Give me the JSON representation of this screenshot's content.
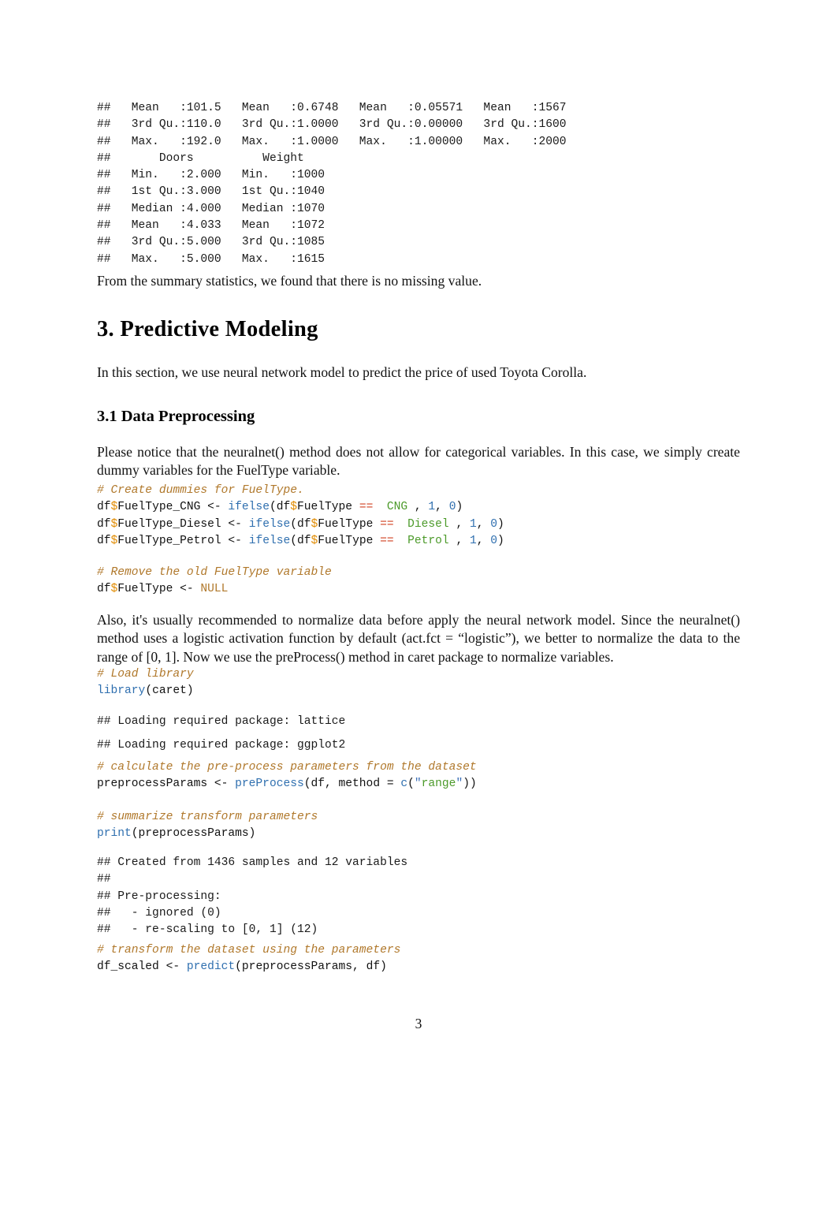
{
  "document": {
    "page_number": "3"
  },
  "summary_output": {
    "lines": [
      "##   Mean   :101.5   Mean   :0.6748   Mean   :0.05571   Mean   :1567",
      "##   3rd Qu.:110.0   3rd Qu.:1.0000   3rd Qu.:0.00000   3rd Qu.:1600",
      "##   Max.   :192.0   Max.   :1.0000   Max.   :1.00000   Max.   :2000",
      "##       Doors          Weight",
      "##   Min.   :2.000   Min.   :1000",
      "##   1st Qu.:3.000   1st Qu.:1040",
      "##   Median :4.000   Median :1070",
      "##   Mean   :4.033   Mean   :1072",
      "##   3rd Qu.:5.000   3rd Qu.:1085",
      "##   Max.   :5.000   Max.   :1615"
    ],
    "text": "##   Mean   :101.5   Mean   :0.6748   Mean   :0.05571   Mean   :1567\n##   3rd Qu.:110.0   3rd Qu.:1.0000   3rd Qu.:0.00000   3rd Qu.:1600\n##   Max.   :192.0   Max.   :1.0000   Max.   :1.00000   Max.   :2000\n##       Doors          Weight\n##   Min.   :2.000   Min.   :1000\n##   1st Qu.:3.000   1st Qu.:1040\n##   Median :4.000   Median :1070\n##   Mean   :4.033   Mean   :1072\n##   3rd Qu.:5.000   3rd Qu.:1085\n##   Max.   :5.000   Max.   :1615"
  },
  "paragraphs": {
    "missing_value": "From the summary statistics, we found that there is no missing value.",
    "section_intro": "In this section, we use neural network model to predict the price of used Toyota Corolla.",
    "notice_categorical": "Please notice that the neuralnet() method does not allow for categorical variables. In this case, we simply create dummy variables for the FuelType variable.",
    "normalize_note": "Also, it's usually recommended to normalize data before apply the neural network model. Since the neuralnet() method uses a logistic activation function by default (act.fct = “logistic”), we better to normalize the data to the range of [0, 1]. Now we use the preProcess() method in caret package to normalize variables."
  },
  "headings": {
    "section_3": "3.  Predictive Modeling",
    "section_3_1": "3.1 Data Preprocessing"
  },
  "code_dummies": {
    "comment": "# Create dummies for FuelType.",
    "line1": {
      "var": "df",
      "dollar": "$",
      "field": "FuelType_CNG",
      "assign": " <- ",
      "fn": "ifelse",
      "open": "(df",
      "dollar2": "$",
      "field2": "FuelType ",
      "eq": "==",
      "string": "  CNG ",
      "comma": ", ",
      "one": "1",
      "comma2": ", ",
      "zero": "0",
      "close": ")"
    },
    "line2": {
      "var": "df",
      "dollar": "$",
      "field": "FuelType_Diesel",
      "assign": " <- ",
      "fn": "ifelse",
      "open": "(df",
      "dollar2": "$",
      "field2": "FuelType ",
      "eq": "==",
      "string": "  Diesel ",
      "comma": ", ",
      "one": "1",
      "comma2": ", ",
      "zero": "0",
      "close": ")"
    },
    "line3": {
      "var": "df",
      "dollar": "$",
      "field": "FuelType_Petrol",
      "assign": " <- ",
      "fn": "ifelse",
      "open": "(df",
      "dollar2": "$",
      "field2": "FuelType ",
      "eq": "==",
      "string": "  Petrol ",
      "comma": ", ",
      "one": "1",
      "comma2": ", ",
      "zero": "0",
      "close": ")"
    }
  },
  "code_remove": {
    "comment": "# Remove the old FuelType variable",
    "var": "df",
    "dollar": "$",
    "field": "FuelType",
    "assign": " <- ",
    "value": "NULL"
  },
  "code_library": {
    "comment": "# Load library",
    "fn": "library",
    "args": "(caret)"
  },
  "output_lattice": "## Loading required package: lattice",
  "output_ggplot": "## Loading required package: ggplot2",
  "code_preprocess": {
    "comment": "# calculate the pre-process parameters from the dataset",
    "var": "preprocessParams <- ",
    "fn": "preProcess",
    "open": "(df, ",
    "arg": "method",
    "eqsign": " = ",
    "cfn": "c",
    "paren": "(",
    "q1": "\"",
    "string": "range",
    "q2": "\"",
    "close": "))"
  },
  "code_print": {
    "comment": "# summarize transform parameters",
    "fn": "print",
    "args": "(preprocessParams)"
  },
  "output_preprocess": {
    "lines": [
      "## Created from 1436 samples and 12 variables",
      "##",
      "## Pre-processing:",
      "##   - ignored (0)",
      "##   - re-scaling to [0, 1] (12)"
    ],
    "text": "## Created from 1436 samples and 12 variables\n##\n## Pre-processing:\n##   - ignored (0)\n##   - re-scaling to [0, 1] (12)"
  },
  "code_transform": {
    "comment": "# transform the dataset using the parameters",
    "var": "df_scaled <- ",
    "fn": "predict",
    "args": "(preprocessParams, df)"
  },
  "colors": {
    "comment": "#B0782B",
    "keyword": "#2F6FAF",
    "dollar": "#E08A00",
    "operator": "#D04020",
    "string": "#4C9A2A",
    "number": "#2F6FAF",
    "text": "#111111"
  }
}
